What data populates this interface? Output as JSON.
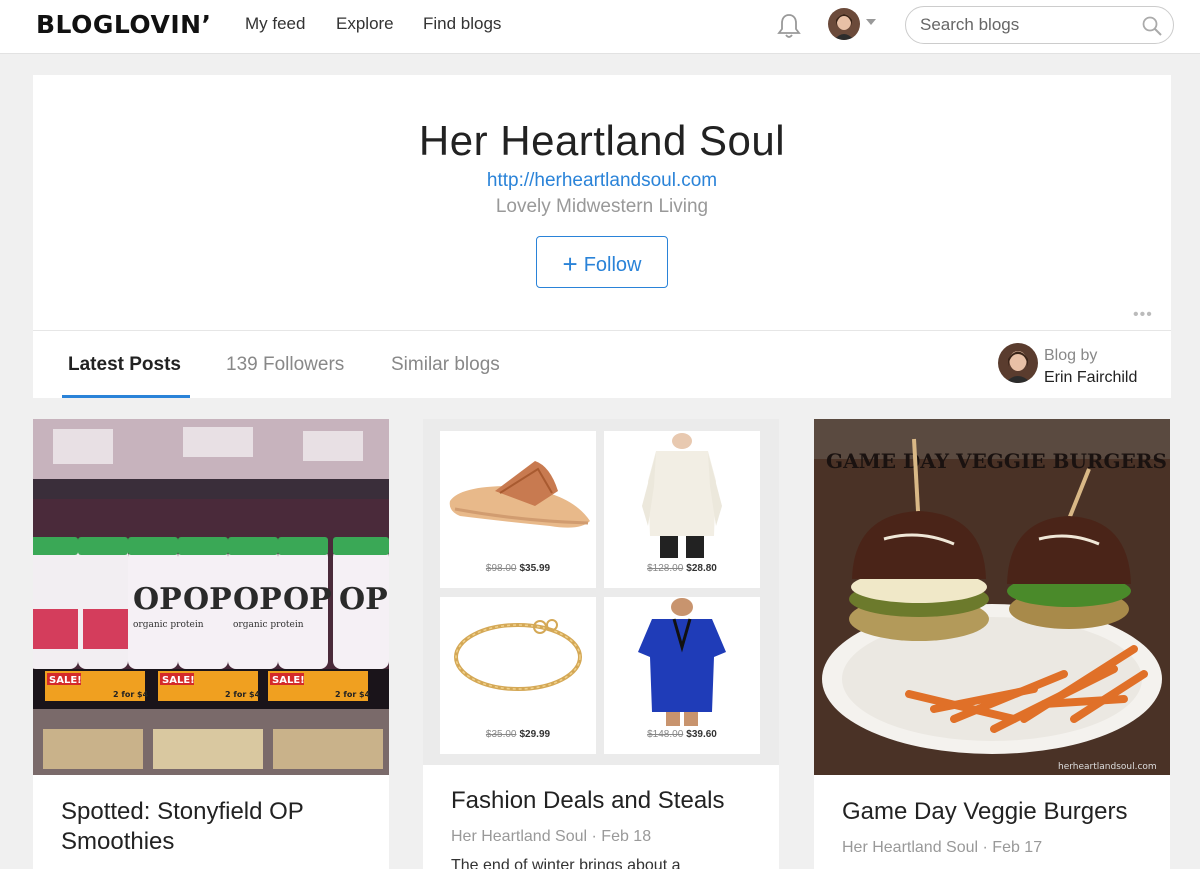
{
  "header": {
    "logo": "BLOGLOVIN’",
    "nav": [
      {
        "label": "My feed"
      },
      {
        "label": "Explore"
      },
      {
        "label": "Find blogs"
      }
    ],
    "search": {
      "placeholder": "Search blogs"
    }
  },
  "blog": {
    "title": "Her Heartland Soul",
    "url": "http://herheartlandsoul.com",
    "tagline": "Lovely Midwestern Living",
    "follow_label": "Follow",
    "more": "•••",
    "tabs": [
      {
        "label": "Latest Posts",
        "active": true
      },
      {
        "label": "139 Followers",
        "active": false
      },
      {
        "label": "Similar blogs",
        "active": false
      }
    ],
    "blog_by_label": "Blog by",
    "author": "Erin Fairchild"
  },
  "posts": [
    {
      "title_line1": "Spotted: Stonyfield OP",
      "title_line2": "Smoothies",
      "image_text": {
        "brand": "OP",
        "label": "organic protein",
        "sale": "SALE!",
        "deal": "2 for $4"
      }
    },
    {
      "title": "Fashion Deals and Steals",
      "meta": "Her Heartland Soul · Feb 18",
      "excerpt": "The end of winter brings about a",
      "products": [
        {
          "old": "$98.00",
          "new": "$35.99"
        },
        {
          "old": "$128.00",
          "new": "$28.80"
        },
        {
          "old": "$35.00",
          "new": "$29.99"
        },
        {
          "old": "$148.00",
          "new": "$39.60"
        }
      ]
    },
    {
      "title": "Game Day Veggie Burgers",
      "meta": "Her Heartland Soul · Feb 17",
      "image_heading": "GAME DAY VEGGIE BURGERS",
      "watermark": "herheartlandsoul.com"
    }
  ],
  "colors": {
    "accent": "#2a83d8",
    "page_bg": "#f0f0f0"
  }
}
